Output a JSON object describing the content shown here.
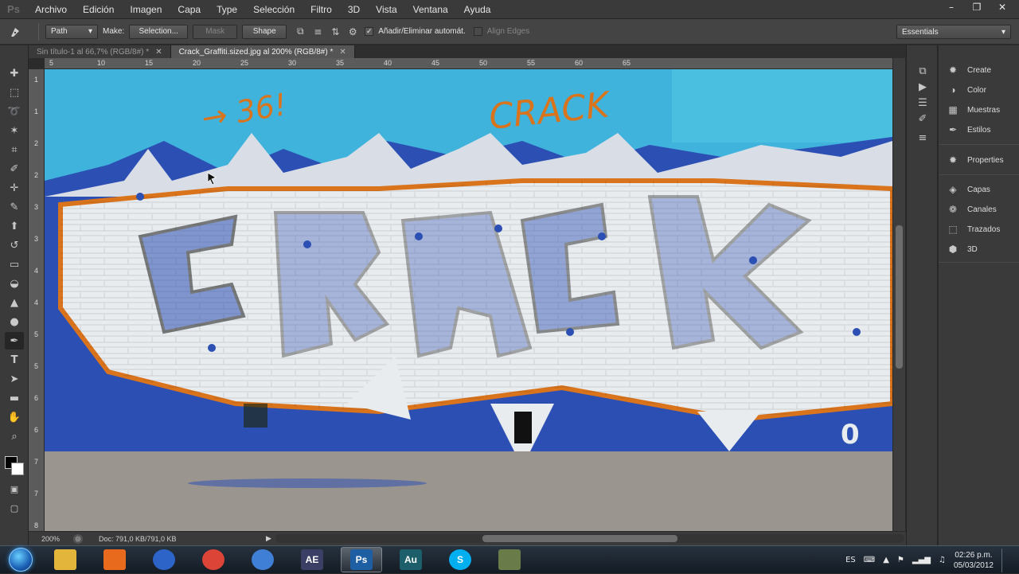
{
  "app": {
    "logo": "Ps"
  },
  "menu": [
    "Archivo",
    "Edición",
    "Imagen",
    "Capa",
    "Type",
    "Selección",
    "Filtro",
    "3D",
    "Vista",
    "Ventana",
    "Ayuda"
  ],
  "window_controls": [
    "minimize-icon",
    "restore-icon",
    "close-icon"
  ],
  "options": {
    "tool_icon": "pen-icon",
    "mode_value": "Path",
    "make_label": "Make:",
    "selection_button": "Selection...",
    "mask_button": "Mask",
    "shape_button": "Shape",
    "auto_add_label": "Añadir/Eliminar automát.",
    "auto_add_checked": true,
    "align_edges_label": "Align Edges",
    "align_edges_checked": false,
    "workspace_value": "Essentials"
  },
  "tabs": [
    {
      "label": "Sin título-1 al 66,7% (RGB/8#) *",
      "active": false
    },
    {
      "label": "Crack_Graffiti.sized.jpg al 200% (RGB/8#) *",
      "active": true
    }
  ],
  "ruler_h": [
    "5",
    "10",
    "15",
    "20",
    "25",
    "30",
    "35",
    "40",
    "45",
    "50",
    "55",
    "60",
    "65"
  ],
  "ruler_v": [
    "1",
    "1",
    "2",
    "2",
    "3",
    "3",
    "4",
    "4",
    "5",
    "5",
    "6",
    "6",
    "7",
    "7",
    "8"
  ],
  "tools": [
    "move-icon",
    "marquee-icon",
    "lasso-icon",
    "quick-select-icon",
    "crop-icon",
    "eyedropper-icon",
    "healing-icon",
    "brush-icon",
    "stamp-icon",
    "history-brush-icon",
    "eraser-icon",
    "paint-bucket-icon",
    "blur-icon",
    "dodge-icon",
    "pen-icon",
    "type-icon",
    "path-select-icon",
    "rectangle-icon",
    "hand-icon",
    "zoom-icon"
  ],
  "canvas": {
    "image_text": "CRACK",
    "wall_text": "CRACK",
    "colors": {
      "sky": "#3fb3dc",
      "white": "#e9ecef",
      "blue": "#2b4fb3",
      "orange": "#d9741d",
      "ground": "#9a958f",
      "outline": "#1a1a1a"
    }
  },
  "status": {
    "zoom": "200%",
    "doc": "Doc: 791,0 KB/791,0 KB"
  },
  "panels": {
    "group1": [
      {
        "label": "Create",
        "icon": "create-icon"
      },
      {
        "label": "Color",
        "icon": "color-icon"
      },
      {
        "label": "Muestras",
        "icon": "swatches-icon"
      },
      {
        "label": "Estilos",
        "icon": "styles-icon"
      }
    ],
    "group2": [
      {
        "label": "Properties",
        "icon": "properties-icon"
      }
    ],
    "group3": [
      {
        "label": "Capas",
        "icon": "layers-icon"
      },
      {
        "label": "Canales",
        "icon": "channels-icon"
      },
      {
        "label": "Trazados",
        "icon": "paths-icon"
      },
      {
        "label": "3D",
        "icon": "3d-icon"
      }
    ]
  },
  "taskbar": {
    "apps": [
      {
        "name": "explorer",
        "label": "",
        "color": "#e3b53b"
      },
      {
        "name": "media-player",
        "label": "",
        "color": "#e86a1c"
      },
      {
        "name": "browser-globe",
        "label": "",
        "color": "#2d64c8"
      },
      {
        "name": "chrome",
        "label": "",
        "color": "#db4437"
      },
      {
        "name": "app-circle",
        "label": "",
        "color": "#3f7fd6"
      },
      {
        "name": "after-effects",
        "label": "AE",
        "color": "#3b3f66"
      },
      {
        "name": "photoshop",
        "label": "Ps",
        "color": "#1e5fa3"
      },
      {
        "name": "audition",
        "label": "Au",
        "color": "#1d5e6b"
      },
      {
        "name": "skype",
        "label": "S",
        "color": "#00aff0"
      },
      {
        "name": "tool-app",
        "label": "",
        "color": "#6a7b4a"
      }
    ],
    "lang": "ES",
    "time": "02:26 p.m.",
    "date": "05/03/2012"
  }
}
